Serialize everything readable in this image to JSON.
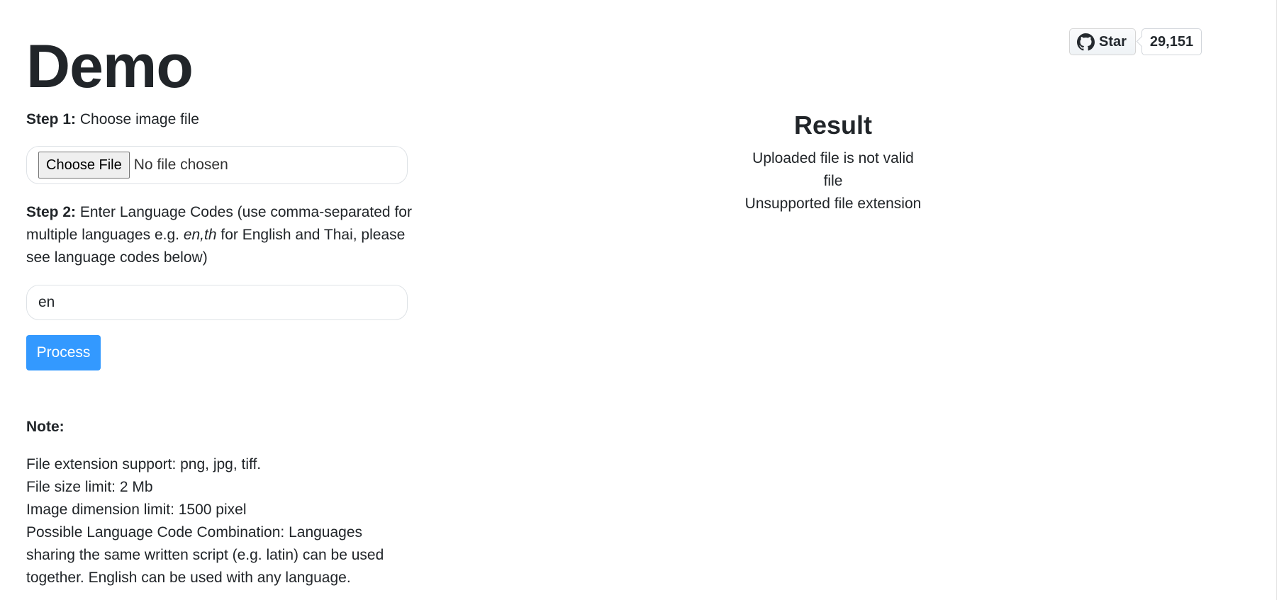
{
  "page": {
    "title": "Demo"
  },
  "step1": {
    "label": "Step 1:",
    "text": " Choose image file",
    "file_button": "Choose File",
    "file_status": "No file chosen"
  },
  "step2": {
    "label": "Step 2:",
    "text_before": " Enter Language Codes (use comma-separated for multiple languages e.g. ",
    "example": "en,th",
    "text_after": " for English and Thai, please see language codes below)",
    "input_value": "en"
  },
  "process_button": "Process",
  "note": {
    "title": "Note:",
    "lines": [
      "File extension support: png, jpg, tiff.",
      "File size limit: 2 Mb",
      "Image dimension limit: 1500 pixel",
      "Possible Language Code Combination: Languages sharing the same written script (e.g. latin) can be used together. English can be used with any language."
    ]
  },
  "github": {
    "star_label": "Star",
    "star_count": "29,151",
    "icon": "github-icon"
  },
  "result": {
    "title": "Result",
    "message": "Uploaded file is not valid file",
    "detail": "Unsupported file extension"
  },
  "colors": {
    "primary_button": "#3399ff",
    "text": "#212529",
    "border": "#dee2e6"
  }
}
